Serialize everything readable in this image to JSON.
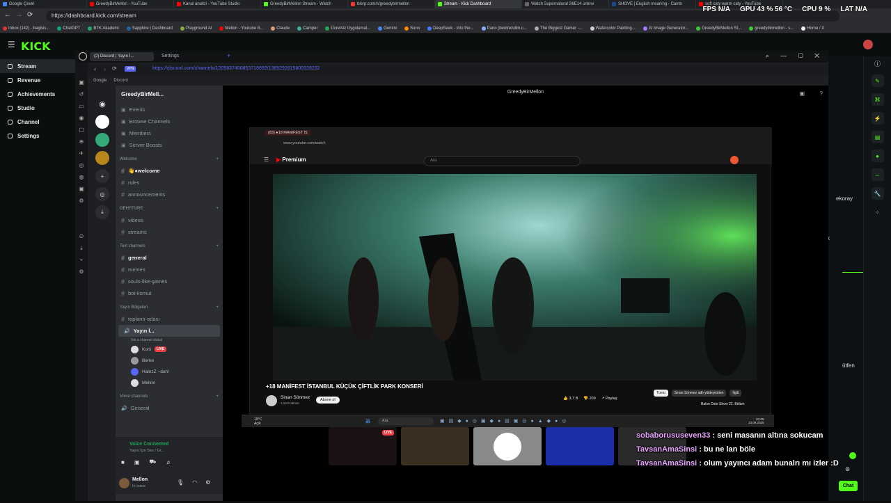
{
  "browser": {
    "tabs": [
      {
        "label": "Google Çeviri",
        "color": "#4285f4"
      },
      {
        "label": "GreedyBirMellon - YouTube",
        "color": "#ff0000"
      },
      {
        "label": "Kanal analizi - YouTube Studio",
        "color": "#ff0000"
      },
      {
        "label": "GreedyBirMellon Stream - Watch",
        "color": "#53fc18"
      },
      {
        "label": "blerp.com/s/greedybirmellon",
        "color": "#e33"
      },
      {
        "label": "Stream - Kick Dashboard",
        "color": "#53fc18"
      },
      {
        "label": "Watch Supernatural S6E14 online",
        "color": "#666"
      },
      {
        "label": "SHOVE | English meaning - Camb",
        "color": "#1a4b8c"
      },
      {
        "label": "soft caty warm caty - YouTube",
        "color": "#ff0000"
      }
    ],
    "url": "https://dashboard.kick.com/stream",
    "bookmarks": [
      "Inbox (142) - bagisis...",
      "ChatGPT",
      "BTK Akademi",
      "Sapphire | Dashboard",
      "Playground AI",
      "Mellon - Youtube 8...",
      "Claude",
      "Camper",
      "Ücretsiz Uygulamal...",
      "Gemini",
      "Suno",
      "DeepSeek - Into the...",
      "Pano (bentrendim.c...",
      "The Biggest Gamer -...",
      "Watercolor Painting...",
      "AI Image Generator...",
      "GreedyBirMellon St...",
      "greedybirmellon - s...",
      "Home / X"
    ]
  },
  "osd": {
    "fps_label": "FPS",
    "fps_value": "N/A",
    "gpu_label": "GPU",
    "gpu_value": "43 % 56 °C",
    "cpu_label": "CPU",
    "cpu_value": "9 %",
    "lat_label": "LAT",
    "lat_value": "N/A"
  },
  "kick": {
    "logo": "KICK",
    "nav": [
      {
        "label": "Stream",
        "active": true
      },
      {
        "label": "Revenue",
        "active": false
      },
      {
        "label": "Achievements",
        "active": false
      },
      {
        "label": "Studio",
        "active": false
      },
      {
        "label": "Channel",
        "active": false
      },
      {
        "label": "Settings",
        "active": false
      }
    ],
    "side_fragments": [
      "ekoray",
      "k",
      "ütfen"
    ],
    "chat_button": "Chat"
  },
  "discord": {
    "tab_label": "(2) Discord | Yayın İ...",
    "settings_tab": "Settings",
    "url": "https://discord.com/channels/1205837400853719892/1385292615800328232",
    "bookmarks": [
      "Google",
      "Discord"
    ],
    "server_name": "GreedyBirMell...",
    "menu": [
      "Events",
      "Browse Channels",
      "Members",
      "Server Boosts"
    ],
    "categories": [
      {
        "name": "Welcome",
        "channels": [
          {
            "name": "👋●welcome",
            "on": true
          },
          {
            "name": "rules",
            "on": false
          },
          {
            "name": "announcements",
            "on": false
          }
        ]
      },
      {
        "name": "GEHSTURE",
        "channels": [
          {
            "name": "videos",
            "on": false
          },
          {
            "name": "streams",
            "on": false
          }
        ]
      },
      {
        "name": "Text channels",
        "channels": [
          {
            "name": "general",
            "on": true
          },
          {
            "name": "memes",
            "on": false
          },
          {
            "name": "souls-like-games",
            "on": false
          },
          {
            "name": "bot-komut",
            "on": false
          }
        ]
      },
      {
        "name": "Yayın Bölgeleri",
        "channels": [
          {
            "name": "toplantı-odası",
            "on": false
          }
        ]
      }
    ],
    "voice_channel": "Yayın İ...",
    "voice_status": "Set a channel status",
    "voice_users": [
      {
        "name": "Korii",
        "live": true
      },
      {
        "name": "Berke",
        "live": false
      },
      {
        "name": "HainzZ ~duh!",
        "live": false
      },
      {
        "name": "Mellon",
        "live": false
      }
    ],
    "live_label": "LIVE",
    "voice_category": "Voice channels",
    "voice_general": "General",
    "voice_connected": "Voice Connected",
    "voice_connected_sub": "Yayın İçin Ses / Gr...",
    "user_name": "Mellon",
    "user_status": "In voice",
    "stage_header": "GreedyBirMellon"
  },
  "share": {
    "tab_label": "(83) ●18 MANIFEST İS",
    "url": "www.youtube.com/watch",
    "yt_logo": "Premium",
    "search_placeholder": "Ara",
    "video_title": "+18 MANİFEST İSTANBUL KÜÇÜK ÇİFTLİK PARK KONSERİ",
    "channel_name": "Sinan Sönmez",
    "subscribers": "1,13 B abone",
    "subscribe": "Abone ol",
    "likes": "3,7 B",
    "dislikes": "209",
    "share": "Paylaş",
    "chips": [
      "Tümü",
      "Sinan Sönmez adlı yükleyiciden",
      "İlgili"
    ],
    "suggest": "Balon Date Show 22. Bölüm",
    "taskbar_search": "Ara",
    "weather_temp": "19°C",
    "weather_text": "Açık",
    "clock": "01:09",
    "date": "13.09.2025"
  },
  "thumbs": [
    {
      "live": "LIVE",
      "bg": "#1a1114"
    },
    {
      "bg": "#3a2f20"
    },
    {
      "bg": "#8a8a8a"
    },
    {
      "bg": "#1d2fa8"
    },
    {
      "bg": "#2a2a2a"
    }
  ],
  "chat": [
    {
      "user": "sobaborususeven33",
      "text": ": seni masanın altına sokucam"
    },
    {
      "user": "TavsanAmaSinsi",
      "text": ": bu ne lan böle"
    },
    {
      "user": "TavsanAmaSinsi",
      "text": ": olum yayıncı adam bunalrı mı izler :D"
    }
  ]
}
